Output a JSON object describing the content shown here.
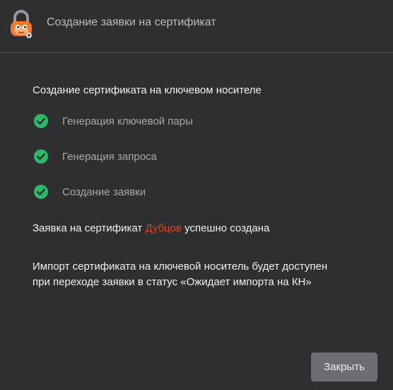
{
  "window": {
    "title": "Создание заявки на сертификат",
    "icon": "padlock-mascot-icon"
  },
  "dialog": {
    "heading": "Создание сертификата на ключевом носителе",
    "steps": [
      {
        "label": "Генерация ключевой пары",
        "status": "done",
        "icon": "check-circle-icon"
      },
      {
        "label": "Генерация запроса",
        "status": "done",
        "icon": "check-circle-icon"
      },
      {
        "label": "Создание заявки",
        "status": "done",
        "icon": "check-circle-icon"
      }
    ],
    "result": {
      "prefix": "Заявка на сертификат ",
      "name": "Дубцов",
      "suffix": " успешно создана"
    },
    "note_line1": "Импорт сертификата на ключевой носитель будет доступен",
    "note_line2": "при переходе заявки в статус «Ожидает импорта на КН»",
    "close_label": "Закрыть"
  },
  "colors": {
    "background": "#2f2f31",
    "success": "#2fb868",
    "accent_name": "#e0451b",
    "button": "#6e6e72"
  }
}
